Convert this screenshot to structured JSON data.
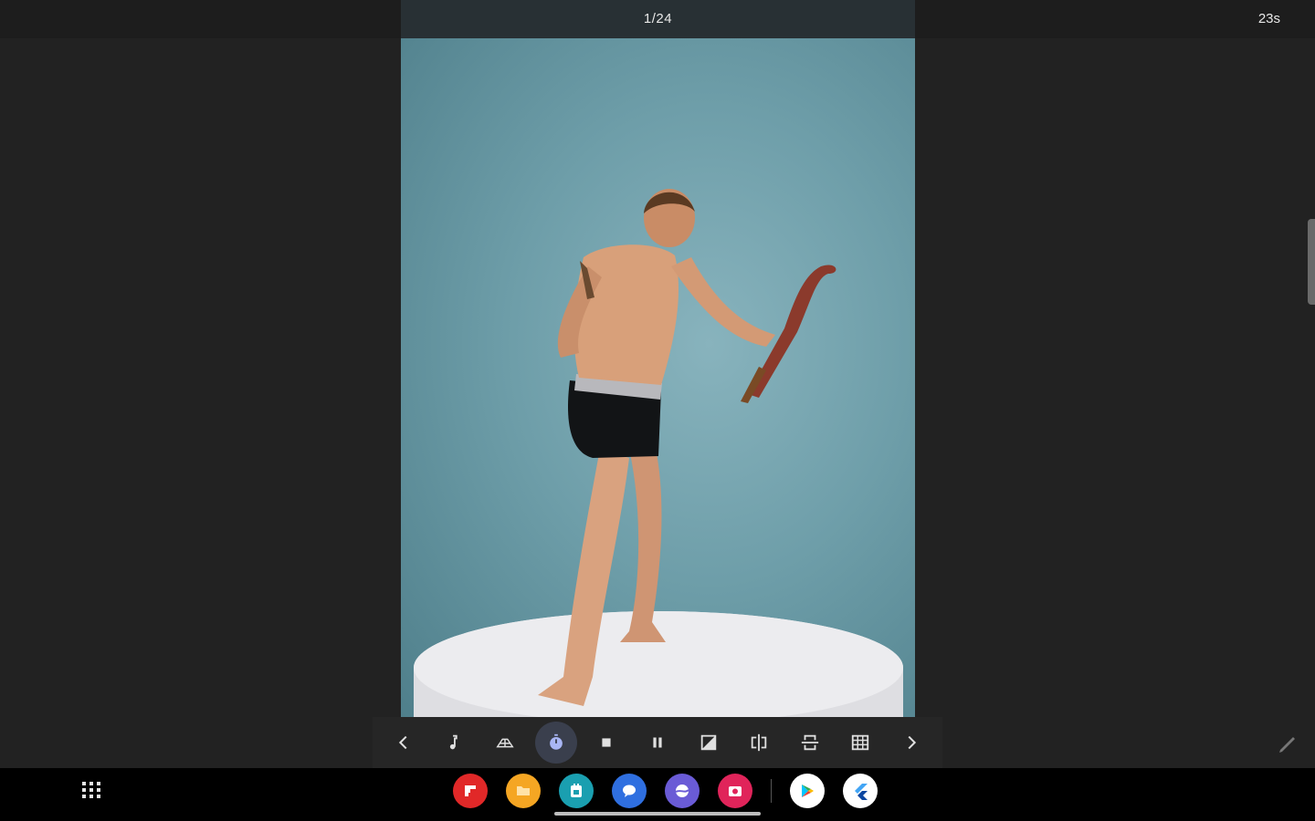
{
  "viewer": {
    "counter": "1/24",
    "timer": "23s"
  },
  "toolbar": {
    "buttons": [
      {
        "name": "previous-button",
        "icon": "chevron-left-icon"
      },
      {
        "name": "music-button",
        "icon": "music-note-icon"
      },
      {
        "name": "grid-lines-button",
        "icon": "perspective-grid-icon"
      },
      {
        "name": "timer-button",
        "icon": "stopwatch-icon",
        "active": true
      },
      {
        "name": "stop-button",
        "icon": "stop-icon"
      },
      {
        "name": "pause-button",
        "icon": "pause-icon"
      },
      {
        "name": "grayscale-button",
        "icon": "contrast-icon"
      },
      {
        "name": "flip-horizontal-button",
        "icon": "flip-horizontal-icon"
      },
      {
        "name": "flip-vertical-button",
        "icon": "flip-vertical-icon"
      },
      {
        "name": "grid-overlay-button",
        "icon": "grid-icon"
      },
      {
        "name": "next-button",
        "icon": "chevron-right-icon"
      }
    ]
  },
  "taskbar": {
    "apps": [
      {
        "name": "flipboard-app",
        "icon": "flipboard-icon",
        "color": "#e12828"
      },
      {
        "name": "my-files-app",
        "icon": "folder-icon",
        "color": "#f5a623"
      },
      {
        "name": "calendar-app",
        "icon": "calendar-icon",
        "color": "#1a9fb0"
      },
      {
        "name": "messages-app",
        "icon": "chat-icon",
        "color": "#2f6fe0"
      },
      {
        "name": "internet-app",
        "icon": "globe-icon",
        "color": "#6a5bd6"
      },
      {
        "name": "camera-app",
        "icon": "camera-icon",
        "color": "#e0245a"
      },
      {
        "name": "play-store-app",
        "icon": "play-store-icon",
        "color": "#ffffff"
      },
      {
        "name": "flutter-app",
        "icon": "flutter-icon",
        "color": "#ffffff"
      }
    ]
  },
  "colors": {
    "background": "#222222",
    "photo_backdrop": "#6e9ea9",
    "active_button": "#3a3f4d"
  }
}
